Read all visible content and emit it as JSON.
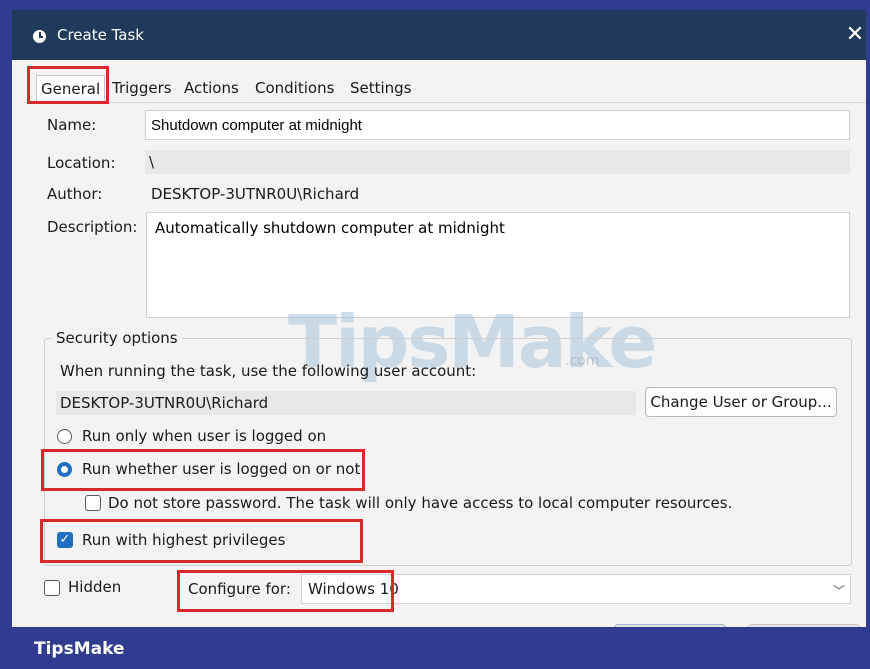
{
  "window": {
    "title": "Create Task"
  },
  "tabs": [
    {
      "label": "General"
    },
    {
      "label": "Triggers"
    },
    {
      "label": "Actions"
    },
    {
      "label": "Conditions"
    },
    {
      "label": "Settings"
    }
  ],
  "general": {
    "name_label": "Name:",
    "name_value": "Shutdown computer at midnight",
    "location_label": "Location:",
    "location_value": "\\",
    "author_label": "Author:",
    "author_value": "DESKTOP-3UTNR0U\\Richard",
    "description_label": "Description:",
    "description_value": "Automatically shutdown computer at midnight"
  },
  "security": {
    "title": "Security options",
    "account_prompt": "When running the task, use the following user account:",
    "account_value": "DESKTOP-3UTNR0U\\Richard",
    "change_button": "Change User or Group...",
    "radio_logged_on": "Run only when user is logged on",
    "radio_whether": "Run whether user is logged on or not",
    "do_not_store": "Do not store password.  The task will only have access to local computer resources.",
    "highest_privileges": "Run with highest privileges"
  },
  "bottom": {
    "hidden_label": "Hidden",
    "configure_label": "Configure for:",
    "configure_value": "Windows 10"
  },
  "watermark": {
    "brand": "TipsMake",
    "suffix": ".com"
  },
  "footer": {
    "brand": "TipsMake"
  },
  "colors": {
    "accent": "#1f6fc2",
    "highlight": "#d62a2a",
    "titlebar": "#1f3a5a",
    "footer": "#2f3c8f"
  }
}
